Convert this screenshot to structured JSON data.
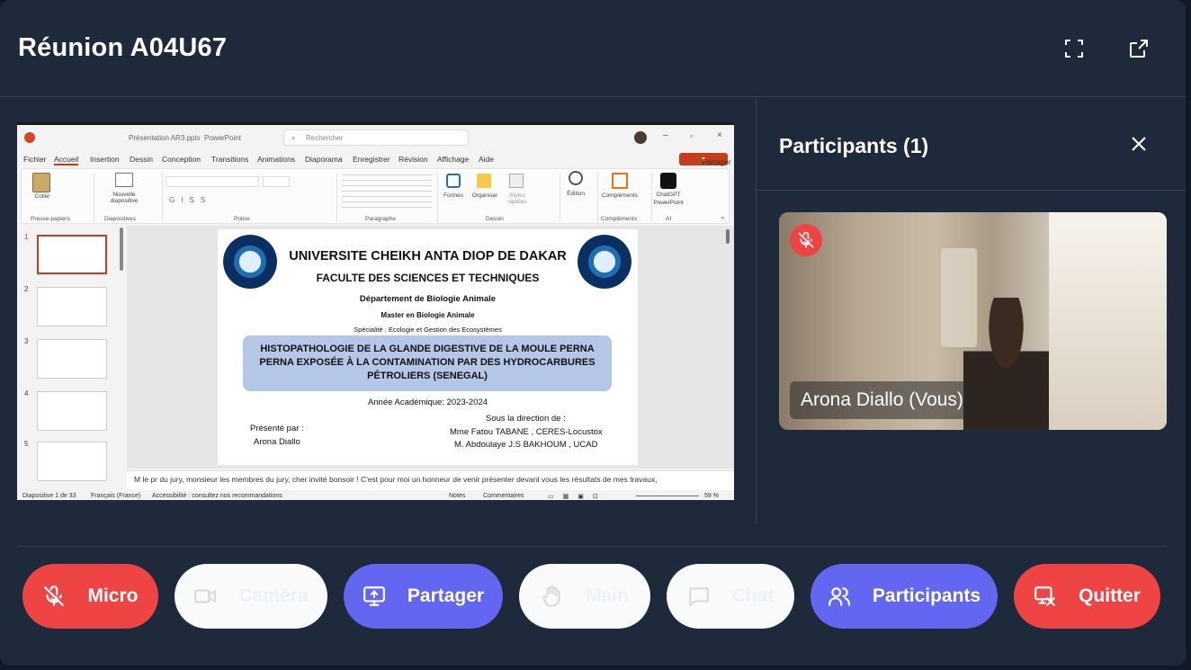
{
  "meeting": {
    "title": "Réunion A04U67"
  },
  "header": {
    "fullscreen_icon": "fullscreen-icon",
    "popout_icon": "external-link-icon"
  },
  "shared_screen": {
    "app": {
      "file_name": "Présentation AR3.pptx",
      "app_name": "PowerPoint",
      "search_placeholder": "Rechercher",
      "menu": [
        "Fichier",
        "Accueil",
        "Insertion",
        "Dessin",
        "Conception",
        "Transitions",
        "Animations",
        "Diaporama",
        "Enregistrer",
        "Révision",
        "Affichage",
        "Aide"
      ],
      "share_button": "Partager",
      "ribbon": {
        "coller": "Coller",
        "nouvelle_diapo": "Nouvelle diapositive",
        "formes": "Formes",
        "organiser": "Organiser",
        "styles": "Styles rapides",
        "edition": "Édition",
        "complements": "Compléments",
        "chatgpt": "ChatGPT PowerPoint",
        "groups": [
          "Presse-papiers",
          "Diapositives",
          "Police",
          "Paragraphe",
          "Dessin",
          "Compléments",
          "AI"
        ]
      },
      "thumb_numbers": [
        "1",
        "2",
        "3",
        "4",
        "5"
      ],
      "slide": {
        "university": "UNIVERSITE CHEIKH ANTA DIOP DE DAKAR",
        "faculty": "FACULTE DES SCIENCES ET TECHNIQUES",
        "department": "Département de Biologie Animale",
        "master": "Master en Biologie Animale",
        "speciality": "Spécialité : Ecologie et Gestion des Ecosystèmes",
        "thesis_title_line1": "HISTOPATHOLOGIE DE LA GLANDE DIGESTIVE DE LA MOULE PERNA",
        "thesis_title_line2": "PERNA EXPOSÉE À LA CONTAMINATION PAR DES HYDROCARBURES",
        "thesis_title_line3": "PÉTROLIERS (SENEGAL)",
        "year": "Année Académique: 2023-2024",
        "presented_by_label": "Présenté par :",
        "presenter": "Arona Diallo",
        "direction_label": "Sous la direction de :",
        "supervisor1": "Mme Fatou TABANE  , CERES-Locustox",
        "supervisor2": "M. Abdoulaye J.S BAKHOUM , UCAD"
      },
      "notes": "M le pr du jury, monsieur les membres du jury, cher  invité bonsoir ! C'est pour moi un honneur de venir présenter devant vous les résultats de mes travaux,",
      "status": {
        "slide_count": "Diapositive 1 de 33",
        "language": "Français (France)",
        "accessibility": "Accessibilité : consultez nos recommandations",
        "notes": "Notes",
        "comments": "Commentaires",
        "zoom": "59 %"
      }
    }
  },
  "panel": {
    "title": "Participants (1)",
    "participant": {
      "name": "Arona Diallo (Vous)",
      "muted": true
    }
  },
  "controls": [
    {
      "label": "Micro",
      "icon": "mic-off-icon",
      "style": "red"
    },
    {
      "label": "Caméra",
      "icon": "camera-icon",
      "style": "white"
    },
    {
      "label": "Partager",
      "icon": "screen-share-icon",
      "style": "purple"
    },
    {
      "label": "Main",
      "icon": "hand-icon",
      "style": "white"
    },
    {
      "label": "Chat",
      "icon": "chat-icon",
      "style": "white"
    },
    {
      "label": "Participants",
      "icon": "users-icon",
      "style": "purple"
    },
    {
      "label": "Quitter",
      "icon": "leave-icon",
      "style": "red"
    }
  ],
  "colors": {
    "background": "#1e293b",
    "danger": "#ef4444",
    "accent": "#6366f1",
    "border": "#334155"
  }
}
